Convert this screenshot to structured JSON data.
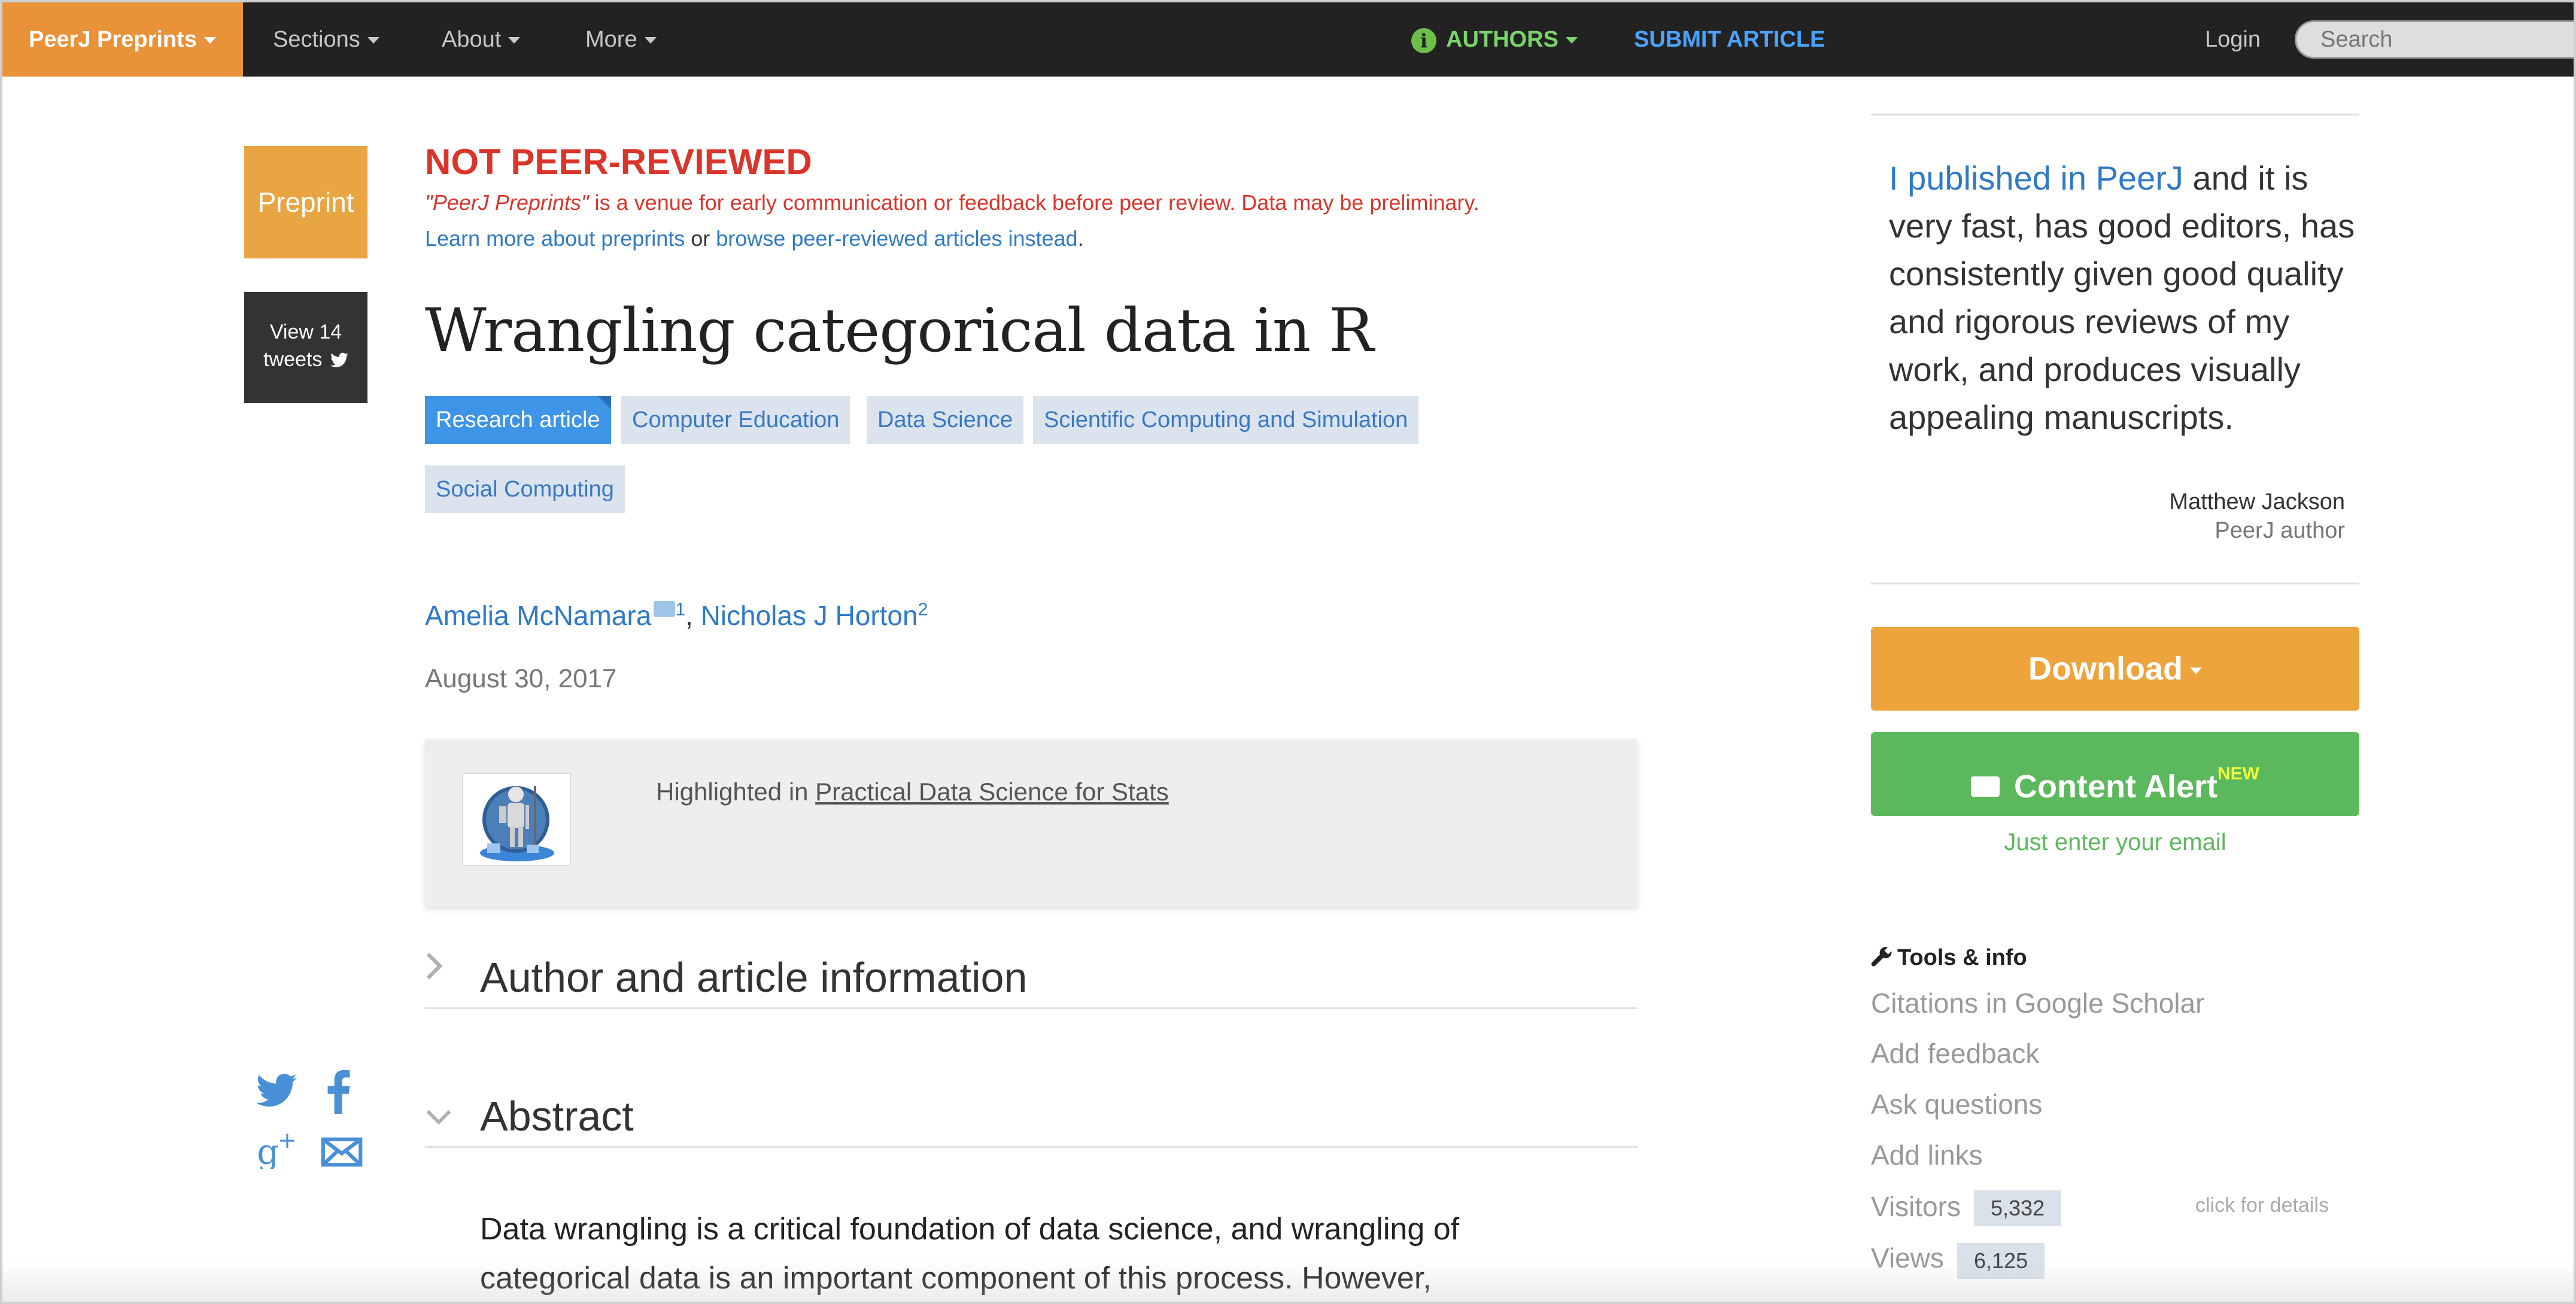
{
  "navbar": {
    "brand": "PeerJ Preprints",
    "sections": "Sections",
    "about": "About",
    "more": "More",
    "authors": "AUTHORS",
    "submit": "SUBMIT ARTICLE",
    "login": "Login",
    "search_placeholder": "Search"
  },
  "left": {
    "preprint_badge": "Preprint",
    "tweets_line1": "View 14",
    "tweets_line2": "tweets"
  },
  "notice": {
    "title": "NOT PEER-REVIEWED",
    "desc_quote": "\"PeerJ Preprints\"",
    "desc_rest": " is a venue for early communication or feedback before peer review. Data may be preliminary.",
    "learn_more": "Learn more about preprints",
    "or": " or ",
    "browse": "browse peer-reviewed articles instead",
    "period": "."
  },
  "article": {
    "title": "Wrangling categorical data in R",
    "tags": [
      "Research article",
      "Computer Education",
      "Data Science",
      "Scientific Computing and Simulation",
      "Social Computing"
    ],
    "authors": [
      {
        "name": "Amelia McNamara",
        "sup": "1"
      },
      {
        "name": "Nicholas J Horton",
        "sup": "2"
      }
    ],
    "author_separator": ",",
    "date": "August 30, 2017",
    "highlight_prefix": "Highlighted in ",
    "highlight_link": "Practical Data Science for Stats",
    "section_author_info": "Author and article information",
    "section_abstract": "Abstract",
    "abstract_line1": "Data wrangling is a critical foundation of data science, and wrangling of",
    "abstract_line2": "categorical data is an important component of this process. However,"
  },
  "sidebar": {
    "quote_link": "I published in PeerJ",
    "quote_rest": " and it is very fast, has good editors, has consistently given good quality and rigorous reviews of my work, and produces visually appealing manuscripts.",
    "quote_author": "Matthew Jackson",
    "quote_role": "PeerJ author",
    "download": "Download",
    "content_alert": "Content Alert",
    "new_badge": "NEW",
    "email_hint": "Just enter your email",
    "tools_title": "Tools & info",
    "tools": [
      "Citations in Google Scholar",
      "Add feedback",
      "Ask questions",
      "Add links"
    ],
    "visitors_label": "Visitors",
    "visitors_value": "5,332",
    "click_details": "click for details",
    "views_label": "Views",
    "views_value": "6,125"
  },
  "colors": {
    "brand": "#e8923a",
    "navbar": "#222222",
    "warning": "#d9352b",
    "link": "#2f79c6",
    "download": "#eda43c",
    "alert": "#5cb85c"
  }
}
